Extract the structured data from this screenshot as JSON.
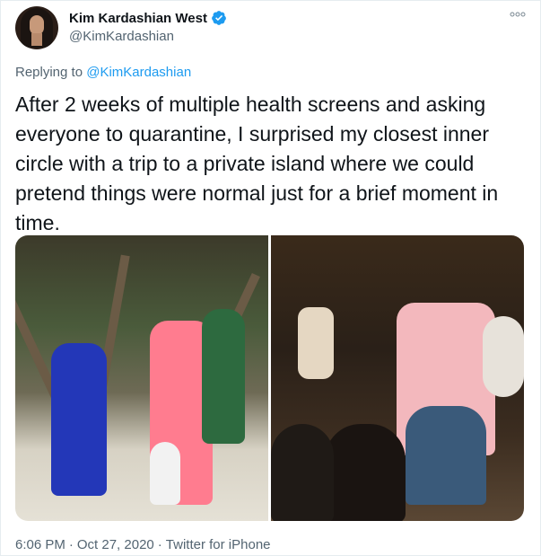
{
  "author": {
    "display_name": "Kim Kardashian West",
    "handle": "@KimKardashian",
    "verified": true
  },
  "reply": {
    "prefix": "Replying to",
    "mention": "@KimKardashian"
  },
  "tweet": {
    "text": "After 2 weeks of multiple health screens and asking everyone to quarantine, I surprised my closest inner circle with a trip to a private island where we could pretend things were normal just for a brief moment in time."
  },
  "meta": {
    "time": "6:06 PM",
    "date": "Oct 27, 2020",
    "source": "Twitter for iPhone"
  },
  "icons": {
    "verified": "verified-badge-icon",
    "more": "more-options-icon"
  },
  "colors": {
    "accent": "#1d9bf0",
    "secondary_text": "#536471"
  }
}
